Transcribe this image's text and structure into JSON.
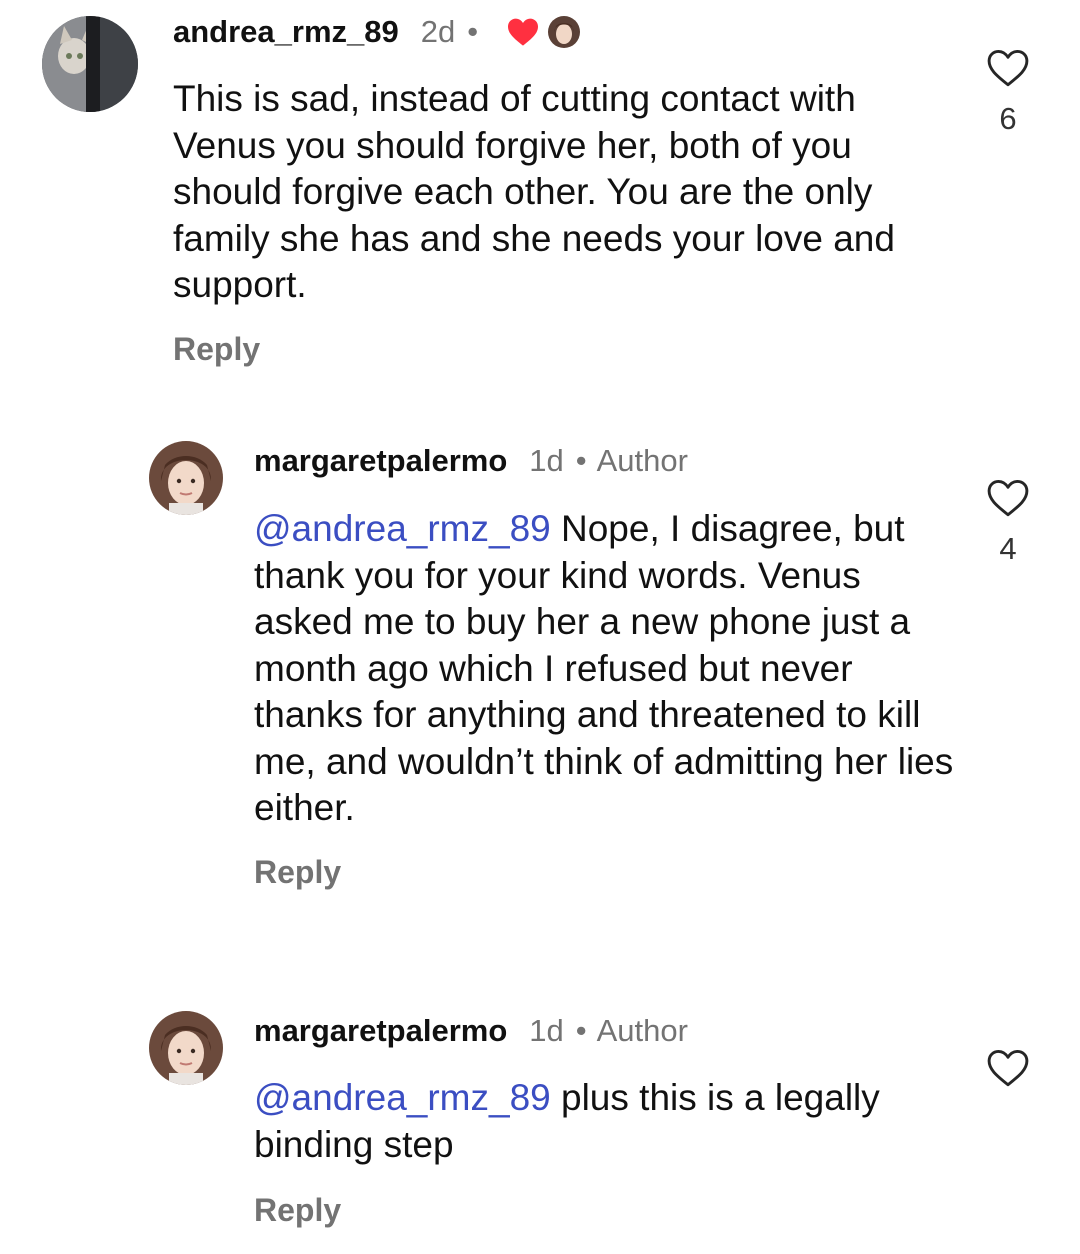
{
  "comments": [
    {
      "username": "andrea_rmz_89",
      "time": "2d",
      "dot": "•",
      "text": "This is sad, instead of cutting contact with Venus you should forgive her, both of you should forgive each other. You are the only family she has and she needs your love and support.",
      "reply_label": "Reply",
      "like_count": "6",
      "liked_by_author": true
    },
    {
      "username": "margaretpalermo",
      "time": "1d",
      "dot": "•",
      "badge": "Author",
      "mention": "@andrea_rmz_89",
      "text": " Nope, I disagree, but thank you for your kind words. Venus asked me to buy her a new phone just a month ago which I refused but never thanks for anything and threatened to kill me, and wouldn’t think of admitting her lies either.",
      "reply_label": "Reply",
      "like_count": "4"
    },
    {
      "username": "margaretpalermo",
      "time": "1d",
      "dot": "•",
      "badge": "Author",
      "mention": "@andrea_rmz_89",
      "text": " plus this is a legally binding step",
      "reply_label": "Reply",
      "like_count": ""
    }
  ],
  "icons": {
    "like": "heart-outline-icon",
    "creator_liked": "heart-filled-icon",
    "accent_heart": "#ff3040",
    "mention_color": "#3b4ec2",
    "muted_color": "#737373"
  }
}
